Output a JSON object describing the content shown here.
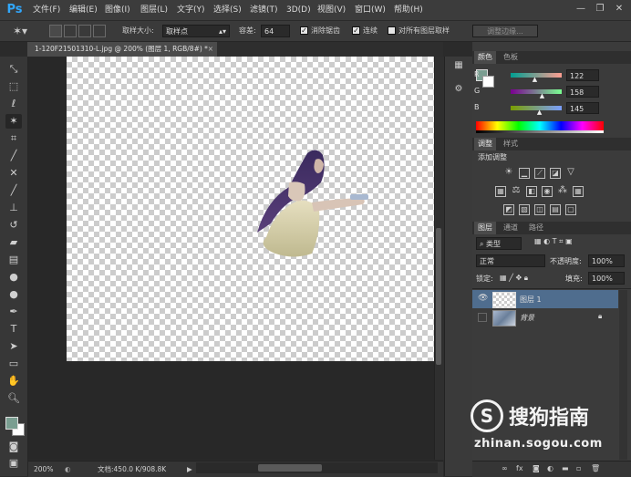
{
  "app": {
    "logo": "Ps"
  },
  "menu": [
    {
      "label": "文件(F)"
    },
    {
      "label": "编辑(E)"
    },
    {
      "label": "图像(I)"
    },
    {
      "label": "图层(L)"
    },
    {
      "label": "文字(Y)"
    },
    {
      "label": "选择(S)"
    },
    {
      "label": "滤镜(T)"
    },
    {
      "label": "3D(D)"
    },
    {
      "label": "视图(V)"
    },
    {
      "label": "窗口(W)"
    },
    {
      "label": "帮助(H)"
    }
  ],
  "window_controls": {
    "minimize": "—",
    "restore": "❐",
    "close": "✕"
  },
  "options": {
    "sample_size_label": "取样大小:",
    "sample_size_value": "取样点",
    "tolerance_label": "容差:",
    "tolerance_value": "64",
    "antialias_label": "消除锯齿",
    "contiguous_label": "连续",
    "all_layers_label": "对所有图层取样",
    "refine_edge_label": "调整边缘..."
  },
  "document": {
    "tab_title": "1-120F21501310-L.jpg @ 200% (图层 1, RGB/8#) *",
    "tab_close": "×"
  },
  "status": {
    "zoom": "200%",
    "doc_info": "文档:450.0 K/908.8K"
  },
  "color_panel": {
    "tabs": [
      "颜色",
      "色板"
    ],
    "channels": [
      {
        "name": "R",
        "value": "122",
        "level": 0.478
      },
      {
        "name": "G",
        "value": "158",
        "level": 0.62
      },
      {
        "name": "B",
        "value": "145",
        "level": 0.569
      }
    ],
    "foreground": "#7a9e91",
    "background": "#ffffff"
  },
  "adjustments_panel": {
    "tabs": [
      "调整",
      "样式"
    ],
    "title": "添加调整"
  },
  "layers_panel": {
    "tabs": [
      "图层",
      "通道",
      "路径"
    ],
    "filter_kind": "类型",
    "blend_mode": "正常",
    "opacity_label": "不透明度:",
    "opacity_value": "100%",
    "lock_label": "锁定:",
    "fill_label": "填充:",
    "fill_value": "100%",
    "layers": [
      {
        "name": "图层 1",
        "visible": true,
        "selected": true
      },
      {
        "name": "背景",
        "visible": false,
        "selected": false
      }
    ]
  },
  "watermark": {
    "brand": "搜狗指南",
    "url": "zhinan.sogou.com"
  },
  "colors": {
    "accent": "#31a8ff",
    "panel": "#3b3b3b",
    "selected_layer": "#4f6d8e"
  }
}
